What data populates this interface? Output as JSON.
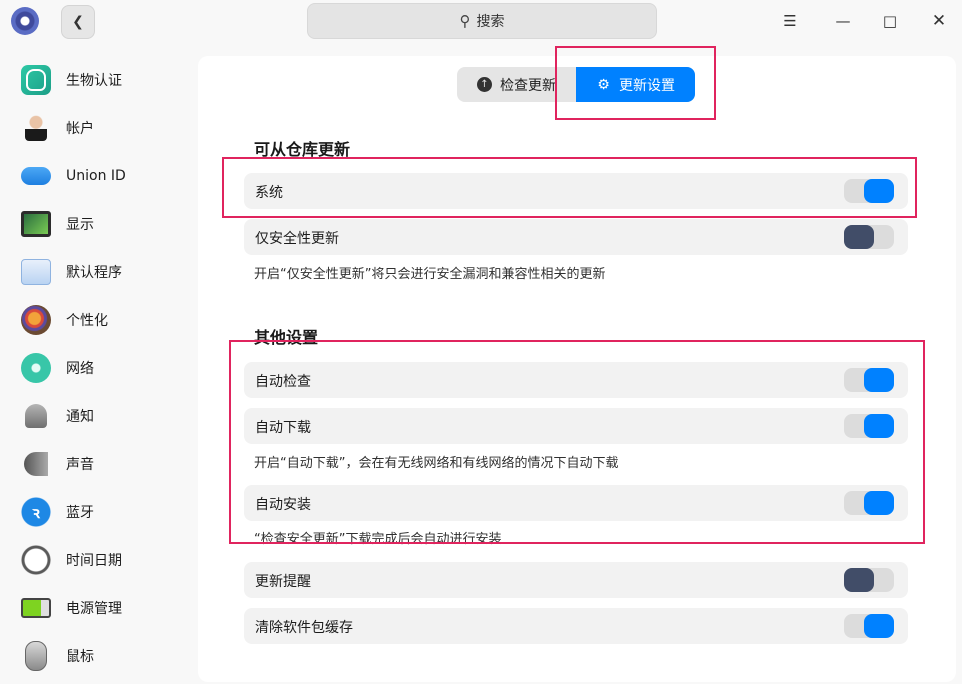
{
  "titlebar": {
    "search_placeholder": "搜索",
    "icons": {
      "back": "chevron-left-icon",
      "search": "magnifier-icon",
      "menu": "hamburger-icon",
      "minimize": "minimize-icon",
      "maximize": "maximize-icon",
      "close": "close-icon"
    }
  },
  "sidebar": {
    "items": [
      {
        "label": "生物认证",
        "icon": "fingerprint-icon"
      },
      {
        "label": "帐户",
        "icon": "account-icon"
      },
      {
        "label": "Union ID",
        "icon": "cloud-icon"
      },
      {
        "label": "显示",
        "icon": "display-icon"
      },
      {
        "label": "默认程序",
        "icon": "default-apps-icon"
      },
      {
        "label": "个性化",
        "icon": "palette-icon"
      },
      {
        "label": "网络",
        "icon": "network-icon"
      },
      {
        "label": "通知",
        "icon": "bell-icon"
      },
      {
        "label": "声音",
        "icon": "speaker-icon"
      },
      {
        "label": "蓝牙",
        "icon": "bluetooth-icon"
      },
      {
        "label": "时间日期",
        "icon": "clock-icon"
      },
      {
        "label": "电源管理",
        "icon": "battery-icon"
      },
      {
        "label": "鼠标",
        "icon": "mouse-icon"
      }
    ]
  },
  "tabs": {
    "check_update": "检查更新",
    "update_settings": "更新设置",
    "active": "update_settings"
  },
  "repo_section": {
    "title": "可从仓库更新",
    "system": {
      "label": "系统",
      "enabled": true
    },
    "security_only": {
      "label": "仅安全性更新",
      "enabled": false
    },
    "security_desc": "开启“仅安全性更新”将只会进行安全漏洞和兼容性相关的更新"
  },
  "other_section": {
    "title": "其他设置",
    "auto_check": {
      "label": "自动检查",
      "enabled": true
    },
    "auto_download": {
      "label": "自动下载",
      "enabled": true
    },
    "auto_download_desc": "开启“自动下载”，会在有无线网络和有线网络的情况下自动下载",
    "auto_install": {
      "label": "自动安装",
      "enabled": true
    },
    "auto_install_desc": "“检查安全更新”下载完成后会自动进行安装",
    "update_reminder": {
      "label": "更新提醒",
      "enabled": false
    },
    "clear_cache": {
      "label": "清除软件包缓存",
      "enabled": true
    }
  },
  "colors": {
    "accent": "#0081ff",
    "toggle_off": "#414d68",
    "highlight": "#e0245e"
  }
}
